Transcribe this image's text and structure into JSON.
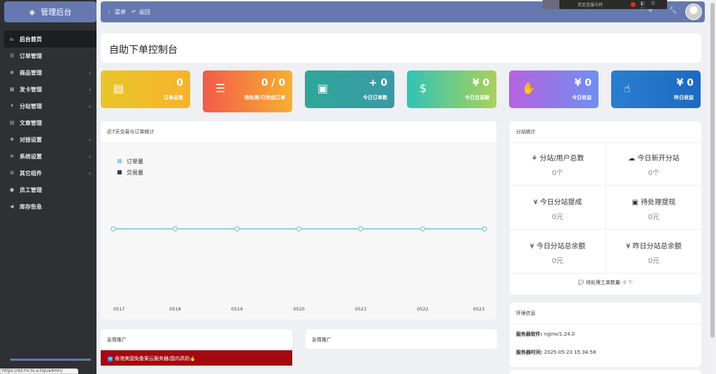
{
  "brand": {
    "title": "管理后台",
    "icon": "cube-icon"
  },
  "nav": [
    {
      "label": "后台首页",
      "icon": "home-icon",
      "glyph": "⌂",
      "active": true,
      "chevron": false
    },
    {
      "label": "订单管理",
      "icon": "list-icon",
      "glyph": "☰",
      "chevron": false
    },
    {
      "label": "商品管理",
      "icon": "cart-icon",
      "glyph": "⊕",
      "chevron": true
    },
    {
      "label": "发卡管理",
      "icon": "grid-icon",
      "glyph": "▦",
      "chevron": true
    },
    {
      "label": "分站管理",
      "icon": "sitemap-icon",
      "glyph": "⚘",
      "chevron": true
    },
    {
      "label": "文章管理",
      "icon": "book-icon",
      "glyph": "▤",
      "chevron": false
    },
    {
      "label": "对接设置",
      "icon": "cubes-icon",
      "glyph": "❖",
      "chevron": true
    },
    {
      "label": "系统设置",
      "icon": "gear-icon",
      "glyph": "✲",
      "chevron": true
    },
    {
      "label": "其它组件",
      "icon": "cogs-icon",
      "glyph": "⚙",
      "chevron": true
    },
    {
      "label": "员工管理",
      "icon": "user-icon",
      "glyph": "●",
      "chevron": false
    },
    {
      "label": "库存告急",
      "icon": "bullhorn-icon",
      "glyph": "◀",
      "chevron": false
    }
  ],
  "topbar": {
    "menu_label": "菜单",
    "back_label": "返回",
    "overlay_text": "变定信服与特"
  },
  "status_url": "https://dd.mi.to.a.top/admin/",
  "page_title": "自助下单控制台",
  "stats": [
    {
      "value": "0",
      "label": "订单总数",
      "icon": "table-icon",
      "glyph": "▤"
    },
    {
      "value": "0 / 0",
      "label": "待处理/已完成订单",
      "icon": "sliders-icon",
      "glyph": "☰"
    },
    {
      "value": "+ 0",
      "label": "今日订单数",
      "icon": "calendar-plus-icon",
      "glyph": "▣"
    },
    {
      "value": "¥ 0",
      "label": "今日交易额",
      "icon": "dollar-icon",
      "glyph": "$"
    },
    {
      "value": "¥ 0",
      "label": "今日收益",
      "icon": "handshake-icon",
      "glyph": "✋"
    },
    {
      "value": "¥ 0",
      "label": "昨日收益",
      "icon": "pointer-icon",
      "glyph": "☝"
    }
  ],
  "chart_panel_title": "近7天交易与订单统计",
  "chart_data": {
    "type": "line",
    "categories": [
      "0517",
      "0518",
      "0519",
      "0520",
      "0521",
      "0522",
      "0523"
    ],
    "series": [
      {
        "name": "订单量",
        "values": [
          0,
          0,
          0,
          0,
          0,
          0,
          0
        ],
        "color": "#8fd0de"
      },
      {
        "name": "交易量",
        "values": [
          0,
          0,
          0,
          0,
          0,
          0,
          0
        ],
        "color": "#3a3a4a"
      }
    ],
    "legend": "top-left"
  },
  "fz": {
    "title": "分站统计",
    "cells": [
      {
        "label": "分站/用户总数",
        "value": "0个",
        "icon": "sitemap-icon",
        "glyph": "⚘"
      },
      {
        "label": "今日新开分站",
        "value": "0个",
        "icon": "cloud-icon",
        "glyph": "☁"
      },
      {
        "label": "今日分站提成",
        "value": "0元",
        "icon": "yen-icon",
        "glyph": "¥"
      },
      {
        "label": "待处理提现",
        "value": "0元",
        "icon": "money-icon",
        "glyph": "▣"
      },
      {
        "label": "今日分站总余额",
        "value": "0元",
        "icon": "yen-icon",
        "glyph": "¥"
      },
      {
        "label": "昨日分站总余额",
        "value": "0元",
        "icon": "yen-icon",
        "glyph": "¥"
      }
    ],
    "pending_label": "待处理工单数量:",
    "pending_value": "0 个"
  },
  "env": {
    "title": "环境信息",
    "server_label": "服务器软件:",
    "server_value": "nginx/1.24.0",
    "time_label": "服务器时间:",
    "time_value": "2025-05-23 15:34:58"
  },
  "links": {
    "title_left": "友情推广",
    "title_right": "友情推广",
    "ad_text": "香港美国免备案云服务器/国内高防🔥"
  }
}
